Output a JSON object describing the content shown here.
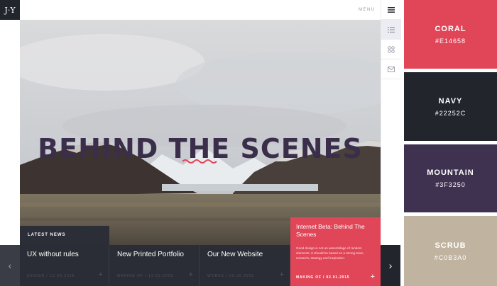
{
  "header": {
    "logo_text": "J·Y",
    "menu_label": "MENU"
  },
  "rail": {
    "items": [
      {
        "icon": "hamburger-icon"
      },
      {
        "icon": "list-icon"
      },
      {
        "icon": "grid-icon"
      },
      {
        "icon": "mail-icon"
      }
    ]
  },
  "hero": {
    "title": "BEHIND THE SCENES"
  },
  "news": {
    "section_label": "LATEST NEWS",
    "prev_arrow": "‹",
    "next_arrow": "›",
    "cards": [
      {
        "title": "UX without rules",
        "meta": "DESIGN / 12.02.2015",
        "plus": "+"
      },
      {
        "title": "New Printed Portfolio",
        "meta": "MAKING OF / 12.02.2015",
        "plus": "+"
      },
      {
        "title": "Our New Website",
        "meta": "WORKS / 09.02.2015",
        "plus": "+"
      }
    ],
    "featured": {
      "title": "Internet Beta: Behind The Scenes",
      "body": "Good design is not an assemblage of random elements. It should be based on a strong team, research, strategy and inspiration.",
      "meta": "MAKING OF / 02.01.2015",
      "plus": "+"
    }
  },
  "palette": [
    {
      "name": "CORAL",
      "hex": "#E14658",
      "color": "#e14658"
    },
    {
      "name": "NAVY",
      "hex": "#22252C",
      "color": "#22252c"
    },
    {
      "name": "MOUNTAIN",
      "hex": "#3F3250",
      "color": "#3f3250"
    },
    {
      "name": "SCRUB",
      "hex": "#C0B3A0",
      "color": "#c0b3a0"
    }
  ]
}
